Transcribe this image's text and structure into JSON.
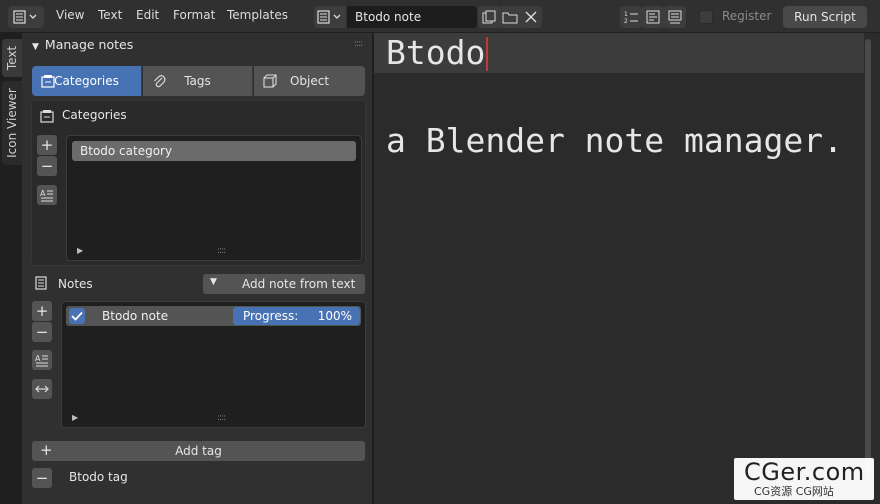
{
  "header": {
    "menus": [
      "View",
      "Text",
      "Edit",
      "Format",
      "Templates"
    ],
    "text_block_name": "Btodo note",
    "register_label": "Register",
    "register_checked": false,
    "run_script_label": "Run Script"
  },
  "vertical_tabs": [
    "Text",
    "Icon Viewer"
  ],
  "sidebar": {
    "panel_title": "Manage notes",
    "segments": [
      {
        "label": "Categories",
        "icon": "category-icon",
        "active": true
      },
      {
        "label": "Tags",
        "icon": "paperclip-icon",
        "active": false
      },
      {
        "label": "Object",
        "icon": "cube-icon",
        "active": false
      }
    ],
    "categories": {
      "title": "Categories",
      "items": [
        "Btodo category"
      ]
    },
    "notes": {
      "title": "Notes",
      "add_from_text_label": "Add note from text",
      "items": [
        {
          "name": "Btodo note",
          "checked": true,
          "progress_label": "Progress:",
          "progress_value": "100%",
          "progress_fraction": 1.0
        }
      ]
    },
    "add_tag_label": "Add tag",
    "tag_name": "Btodo tag"
  },
  "editor": {
    "lines": [
      "Btodo",
      "",
      "a Blender note manager."
    ]
  },
  "watermark": {
    "brand": "CGer.com",
    "subtitle": "CG资源 CG网站"
  },
  "colors": {
    "accent": "#4772b3",
    "cursor": "#c03a3a"
  }
}
